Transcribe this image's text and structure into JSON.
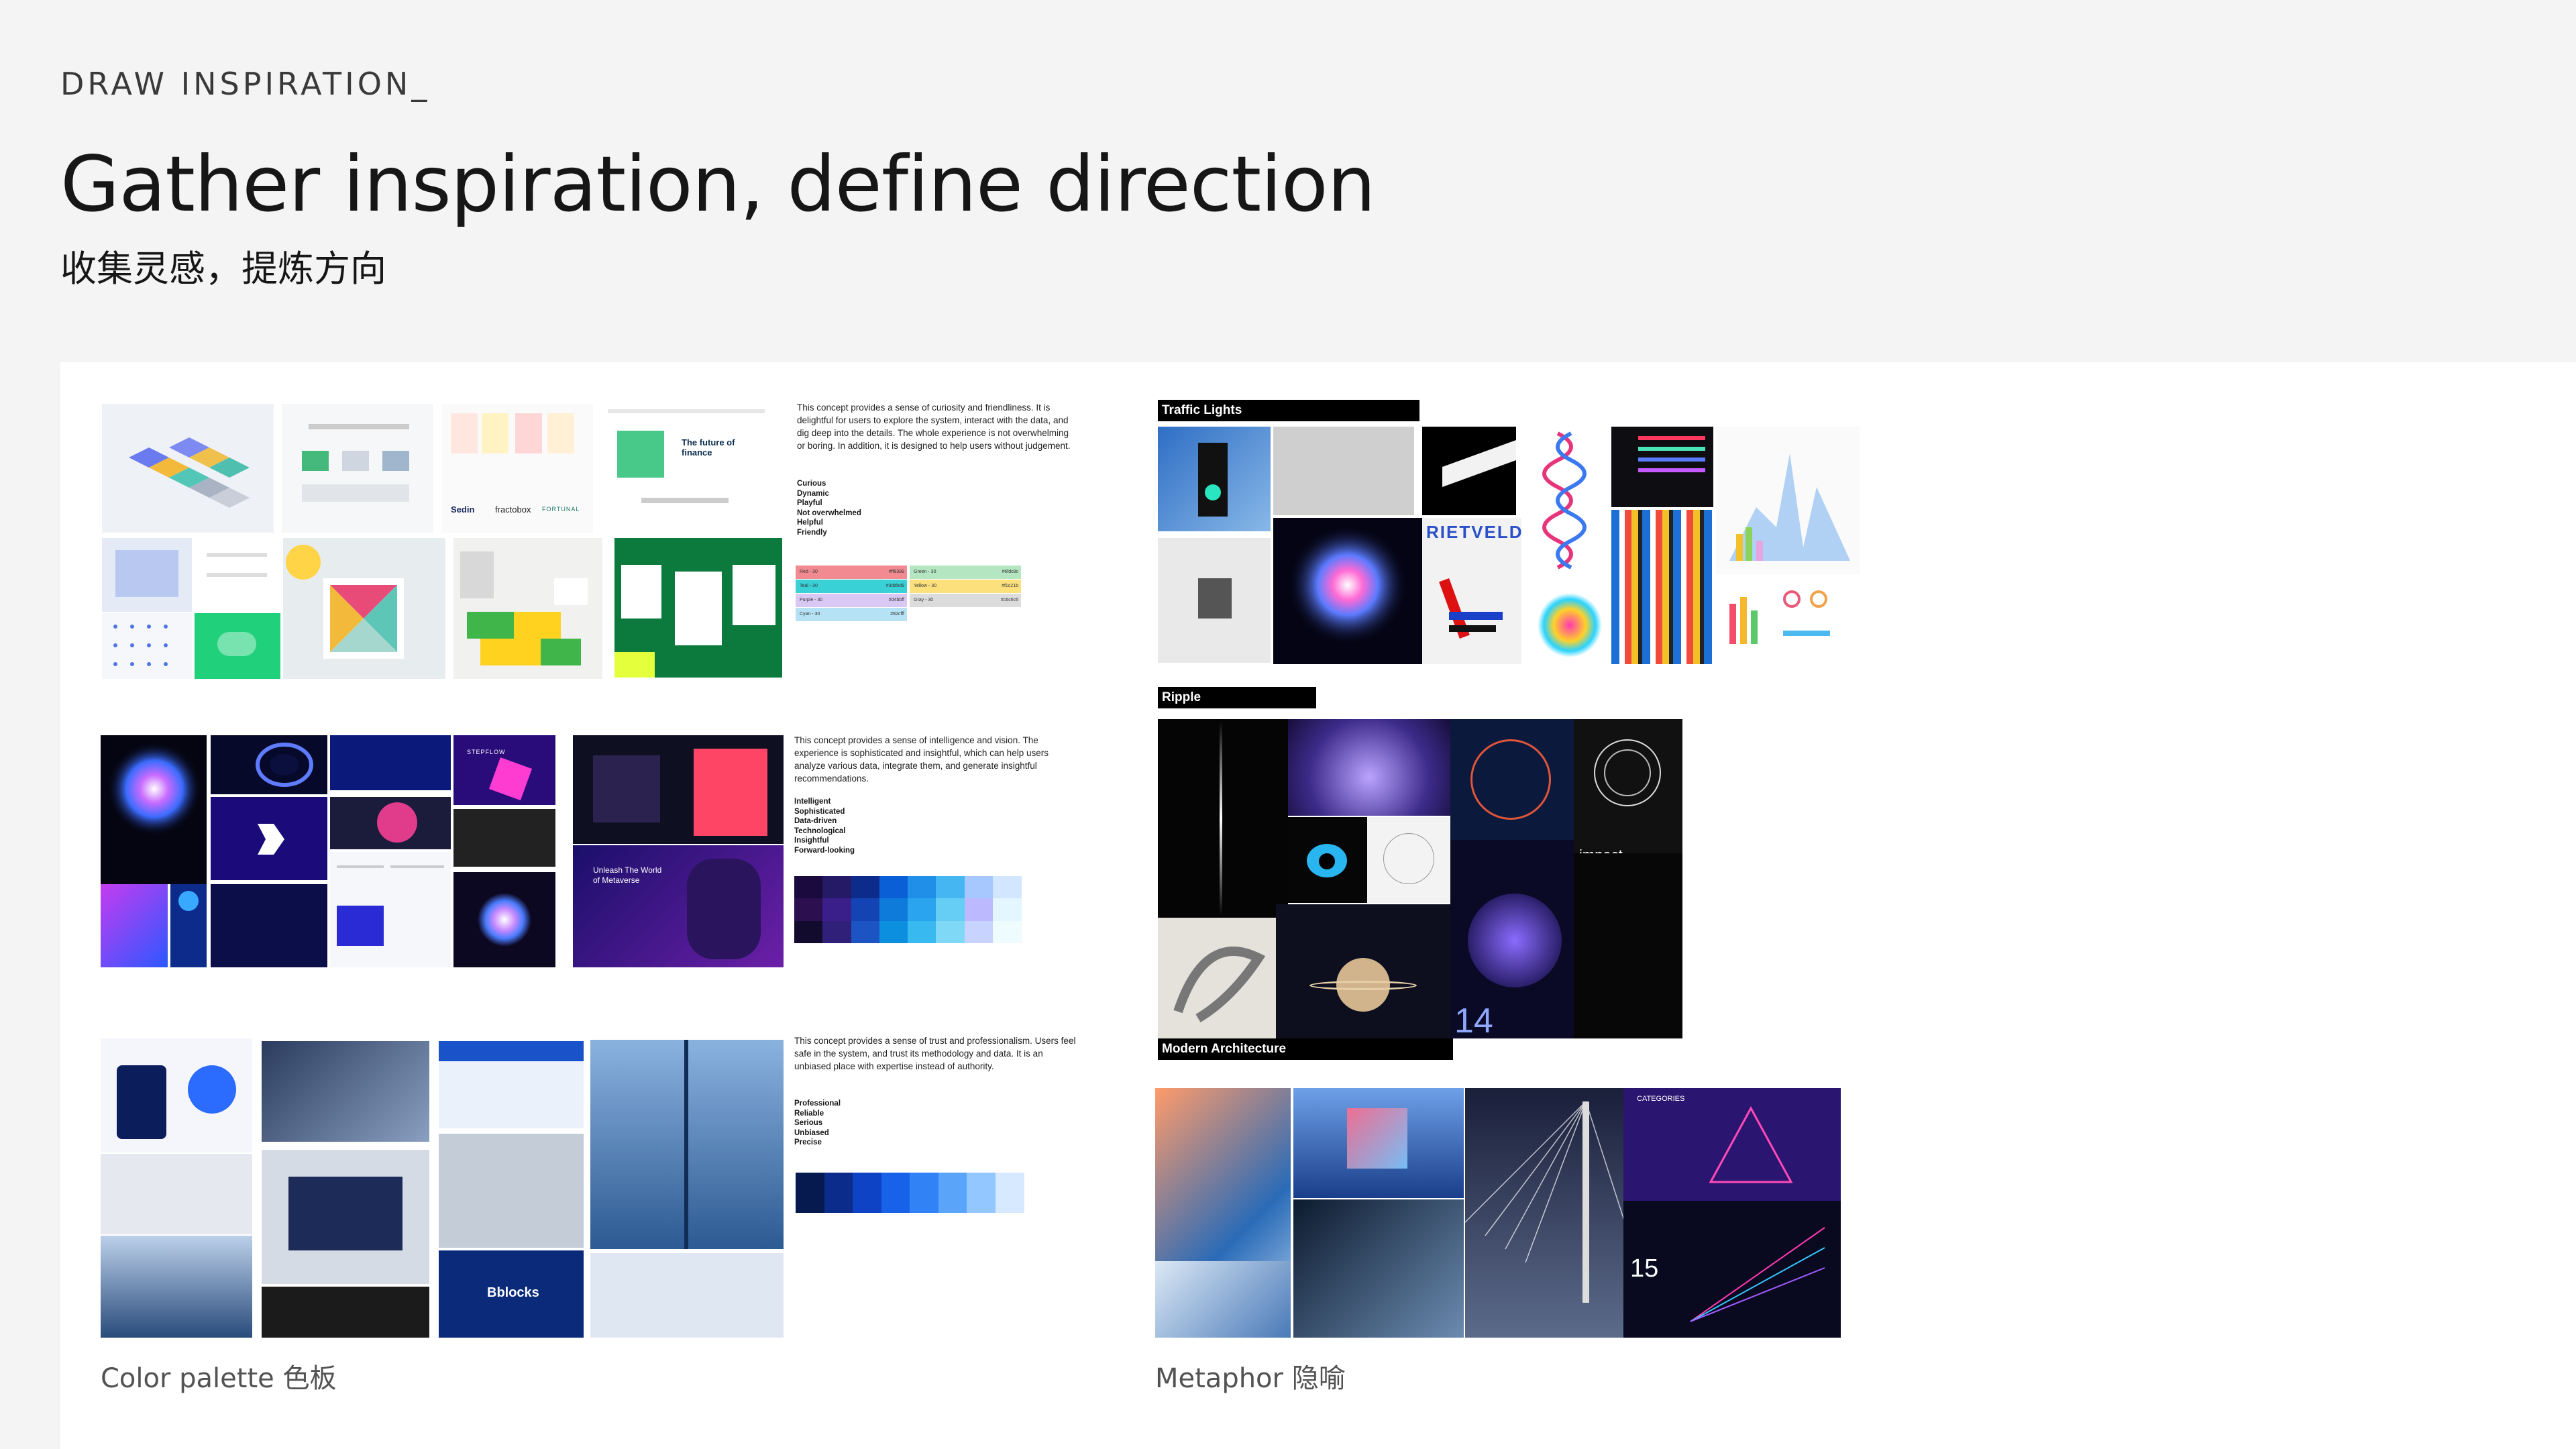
{
  "header": {
    "eyebrow": "DRAW INSPIRATION_",
    "title": "Gather inspiration, define direction",
    "subtitle": "收集灵感，提炼方向"
  },
  "captions": {
    "left": "Color palette 色板",
    "right": "Metaphor 隐喻"
  },
  "concepts": [
    {
      "text": "This concept provides a sense of curiosity and friendliness. It is delightful for users to explore the system, interact with the data, and dig deep into the details. The whole experience is not overwhelming or boring. In addition, it is designed to help users without judgement.",
      "keywords": [
        "Curious",
        "Dynamic",
        "Playful",
        "Not overwhelmed",
        "Helpful",
        "Friendly"
      ]
    },
    {
      "text": "This concept provides a sense of intelligence and vision. The experience is sophisticated and insightful, which can help users analyze various data, integrate them, and generate insightful recommendations.",
      "keywords": [
        "Intelligent",
        "Sophisticated",
        "Data-driven",
        "Technological",
        "Insightful",
        "Forward-looking"
      ]
    },
    {
      "text": "This concept provides a sense of trust and professionalism. Users feel safe in the system, and trust its methodology and data. It is an unbiased place with expertise instead of authority.",
      "keywords": [
        "Professional",
        "Reliable",
        "Serious",
        "Unbiased",
        "Precise"
      ]
    }
  ],
  "palette1": [
    {
      "label": "Red - 30",
      "code": "#ff8389",
      "color": "#f28b91"
    },
    {
      "label": "Green - 30",
      "code": "#6fdc8c",
      "color": "#b4e6c1"
    },
    {
      "label": "Teal - 30",
      "code": "#3ddbd9",
      "color": "#3ad1d6"
    },
    {
      "label": "Yellow - 30",
      "code": "#f1c21b",
      "color": "#fbe07c"
    },
    {
      "label": "Purple - 30",
      "code": "#d4bbff",
      "color": "#d9c8f4"
    },
    {
      "label": "Gray - 30",
      "code": "#c6c6c6",
      "color": "#dcdcdc"
    },
    {
      "label": "Cyan - 30",
      "code": "#82cfff",
      "color": "#b5e2f4"
    }
  ],
  "palette2": [
    "#1b0a3d",
    "#241a66",
    "#0d2b8a",
    "#0a5fd6",
    "#1f8fe8",
    "#45b6f2",
    "#a7c7ff",
    "#d2e7ff",
    "#2b0f4f",
    "#3a1e8a",
    "#1443b4",
    "#0e7ad9",
    "#2aa4ee",
    "#66cdf4",
    "#bcb9ff",
    "#e4f6ff",
    "#120b2e",
    "#31207a",
    "#1c54c4",
    "#0d8fe0",
    "#38b9f0",
    "#7fd8f6",
    "#c8d4ff",
    "#eefbff"
  ],
  "palette3": [
    "#071a4f",
    "#0b2c8a",
    "#0f43c6",
    "#1762e8",
    "#3183f5",
    "#5aa4fa",
    "#93c7ff",
    "#d6e9ff"
  ],
  "metaphor_labels": {
    "traffic": "Traffic Lights",
    "ripple": "Ripple",
    "architecture": "Modern Architecture"
  },
  "thumb_text": {
    "rietveld": "RIETVELD",
    "impact": "impact",
    "bblocks": "Bblocks",
    "num14": "14",
    "num15": "15",
    "unleash": "Unleash The World of Metaverse",
    "categories": "CATEGORIES",
    "finance": "The future of finance",
    "sedin": "Sedin",
    "fracto": "fractobox",
    "fortunal": "FORTUNAL",
    "steplow": "STEPFLOW"
  },
  "colors": {
    "background": "#f4f4f4",
    "board": "#ffffff",
    "ink": "#161616"
  }
}
